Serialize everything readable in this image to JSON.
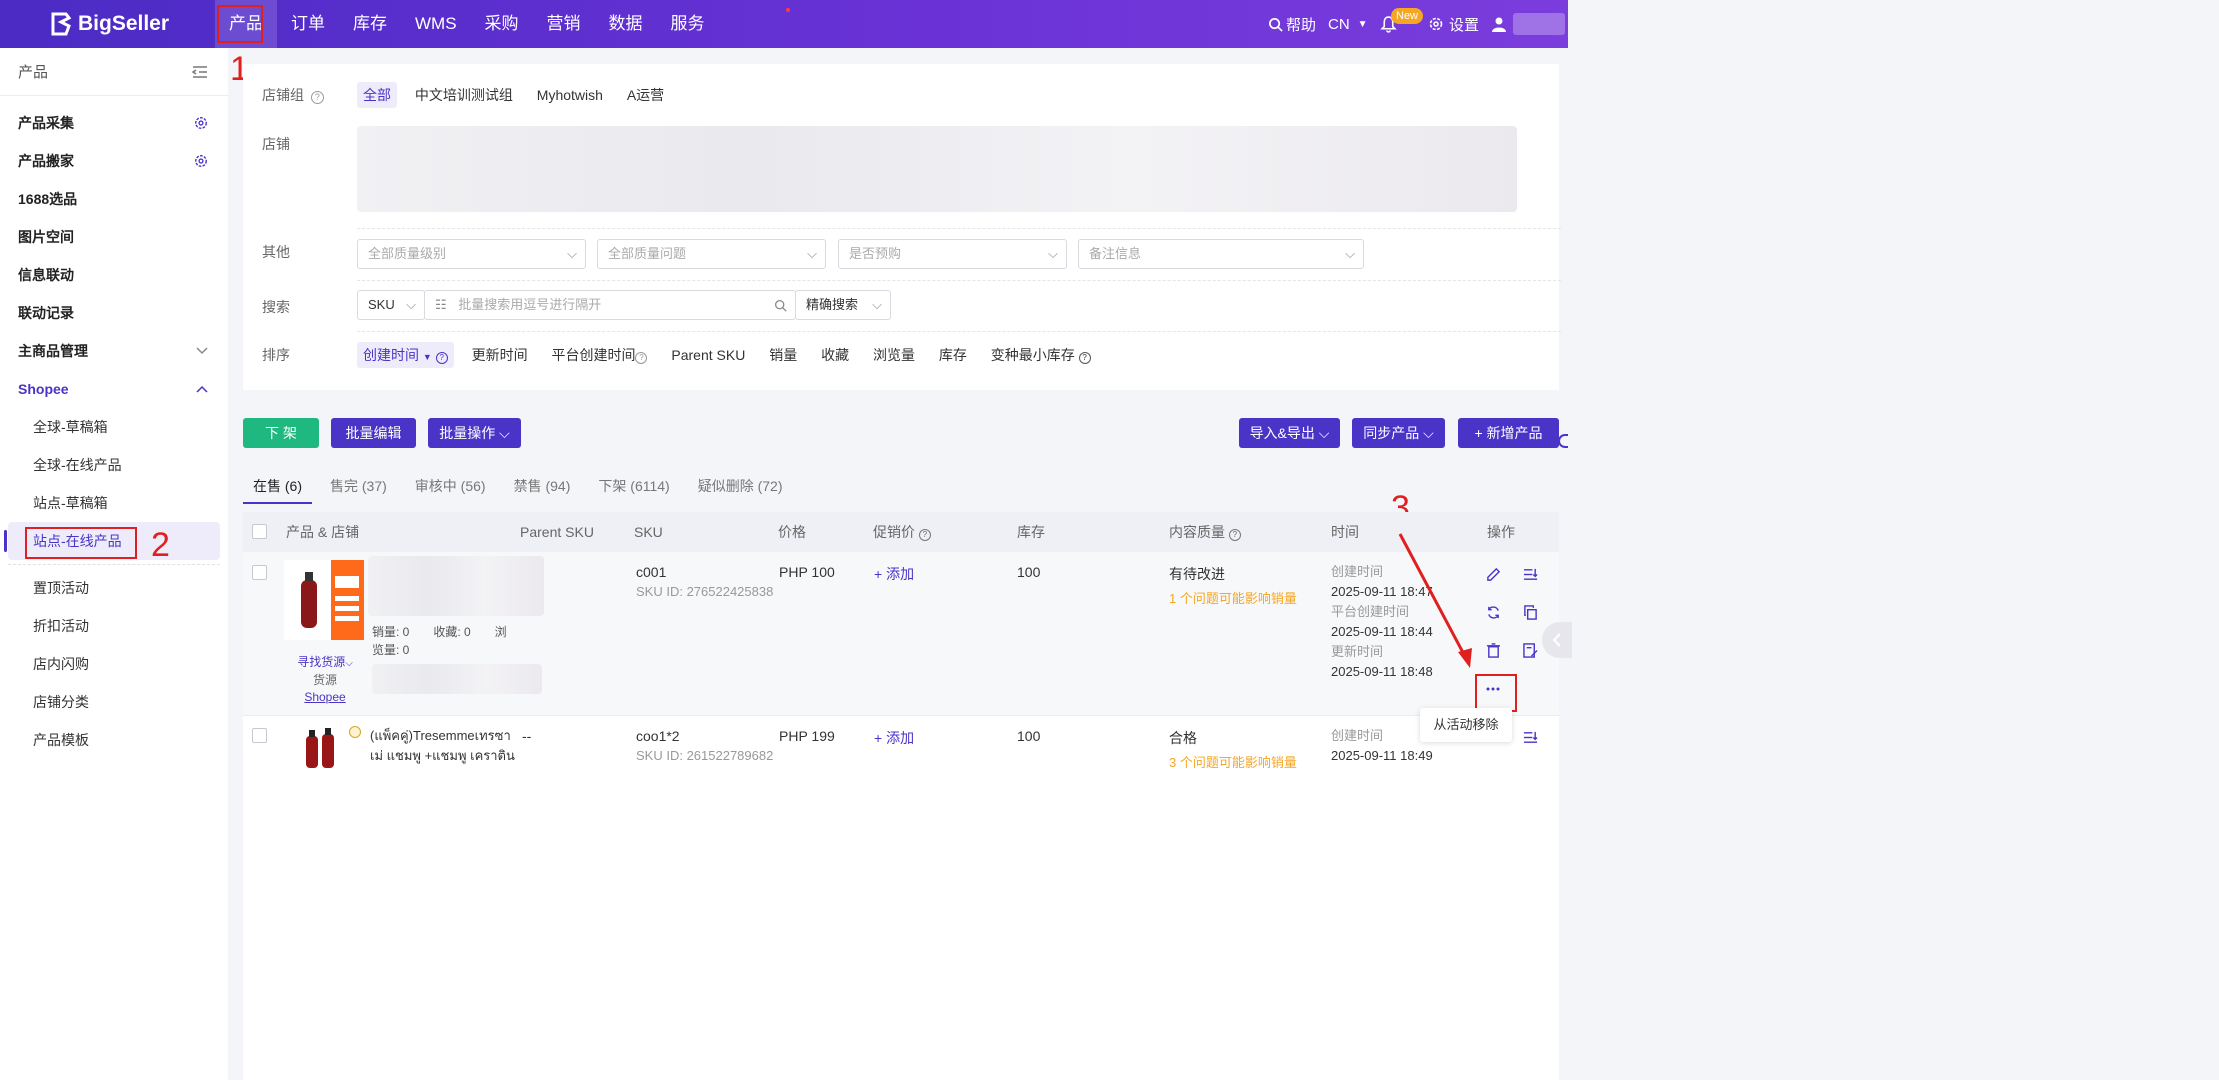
{
  "brand": {
    "name": "BigSeller"
  },
  "topnav": {
    "items": [
      "产品",
      "订单",
      "库存",
      "WMS",
      "采购",
      "营销",
      "数据",
      "服务"
    ],
    "help": "帮助",
    "lang": "CN",
    "new_badge": "New",
    "settings": "设置"
  },
  "sidebar": {
    "title": "产品",
    "items": [
      {
        "label": "产品采集"
      },
      {
        "label": "产品搬家"
      },
      {
        "label": "1688选品"
      },
      {
        "label": "图片空间"
      },
      {
        "label": "信息联动"
      },
      {
        "label": "联动记录"
      },
      {
        "label": "主商品管理"
      },
      {
        "label": "Shopee"
      }
    ],
    "shopee_sub": [
      "全球-草稿箱",
      "全球-在线产品",
      "站点-草稿箱",
      "站点-在线产品",
      "置顶活动",
      "折扣活动",
      "店内闪购",
      "店铺分类",
      "产品模板"
    ]
  },
  "filter": {
    "shop_group_label": "店铺组",
    "shop_groups": [
      "全部",
      "中文培训测试组",
      "Myhotwish",
      "A运营"
    ],
    "shop_label": "店铺",
    "other_label": "其他",
    "selects": [
      "全部质量级别",
      "全部质量问题",
      "是否预购",
      "备注信息"
    ],
    "search_label": "搜索",
    "search_field": "SKU",
    "search_placeholder": "批量搜索用逗号进行隔开",
    "search_mode": "精确搜索",
    "sort_label": "排序",
    "sort_options": [
      "创建时间",
      "更新时间",
      "平台创建时间",
      "Parent SKU",
      "销量",
      "收藏",
      "浏览量",
      "库存",
      "变种最小库存"
    ]
  },
  "actions": {
    "delist": "下 架",
    "batch_edit": "批量编辑",
    "batch_ops": "批量操作",
    "import_export": "导入&导出",
    "sync": "同步产品",
    "add": "+ 新增产品"
  },
  "tabs": [
    "在售 (6)",
    "售完 (37)",
    "审核中 (56)",
    "禁售 (94)",
    "下架 (6114)",
    "疑似删除 (72)"
  ],
  "table": {
    "headers": [
      "产品 & 店铺",
      "Parent SKU",
      "SKU",
      "价格",
      "促销价",
      "库存",
      "内容质量",
      "时间",
      "操作"
    ],
    "rows": [
      {
        "stats_line1": "销量: 0　　收藏: 0　　浏",
        "stats_line2": "览量: 0",
        "source_link": "寻找货源",
        "source_label": "货源",
        "source_platform": "Shopee",
        "parent_sku": "",
        "sku": "c001",
        "sku_id": "SKU ID: 276522425838",
        "price": "PHP 100",
        "promo": "+ 添加",
        "stock": "100",
        "quality": "有待改进",
        "quality_issue": "1 个问题可能影响销量",
        "created_label": "创建时间",
        "created": "2025-09-11 18:47",
        "platform_created_label": "平台创建时间",
        "platform_created": "2025-09-11 18:44",
        "updated_label": "更新时间",
        "updated": "2025-09-11 18:48"
      },
      {
        "title_line1": "(แพ็คคู่)Tresemmeเทรซา",
        "title_line2": "เม่ แชมพู +แชมพู เคราติน",
        "parent_sku": "--",
        "sku": "coo1*2",
        "sku_id": "SKU ID: 261522789682",
        "price": "PHP 199",
        "promo": "+ 添加",
        "stock": "100",
        "quality": "合格",
        "quality_issue": "3 个问题可能影响销量",
        "created_label": "创建时间",
        "created": "2025-09-11 18:49"
      }
    ]
  },
  "tooltip": {
    "remove_from_activity": "从活动移除"
  },
  "annotations": [
    "1",
    "2",
    "3"
  ],
  "colors": {
    "accent": "#4a34c7",
    "green": "#1fb880",
    "red": "#e02020",
    "orange": "#f5a623"
  }
}
